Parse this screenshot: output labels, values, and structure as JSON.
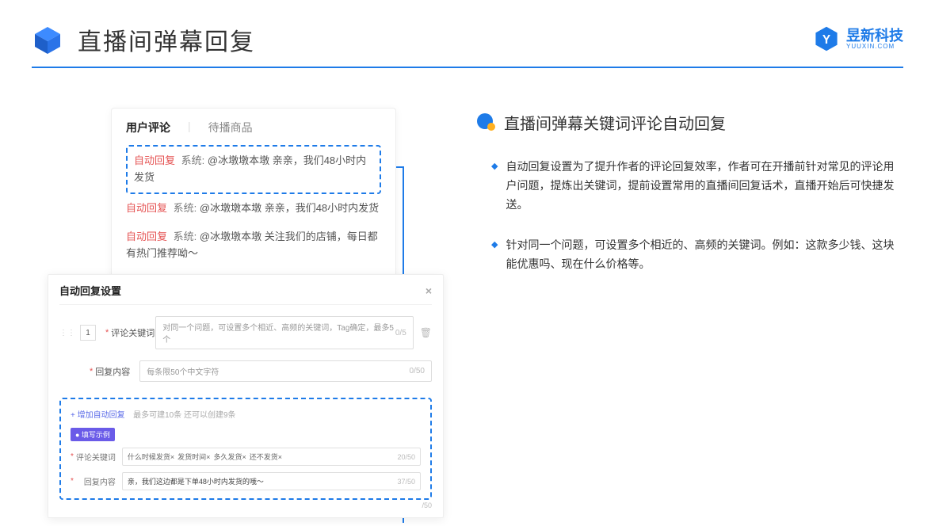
{
  "header": {
    "title": "直播间弹幕回复"
  },
  "brand": {
    "name": "昱新科技",
    "sub": "YUUXIN.COM"
  },
  "comments": {
    "tab1": "用户评论",
    "tab2": "待播商品",
    "r1_tag": "自动回复",
    "r1_sys": "系统:",
    "r1_text": "@冰墩墩本墩 亲亲，我们48小时内发货",
    "r2_tag": "自动回复",
    "r2_sys": "系统:",
    "r2_text": "@冰墩墩本墩 亲亲，我们48小时内发货",
    "r3_tag": "自动回复",
    "r3_sys": "系统:",
    "r3_text": "@冰墩墩本墩 关注我们的店铺，每日都有热门推荐呦～"
  },
  "settings": {
    "title": "自动回复设置",
    "num": "1",
    "label_keyword": "评论关键词",
    "placeholder_keyword": "对同一个问题，可设置多个相近、高频的关键词，Tag确定，最多5个",
    "count_kw": "0/5",
    "label_content": "回复内容",
    "placeholder_content": "每条限50个中文字符",
    "count_ct": "0/50",
    "add_link": "+ 增加自动回复",
    "add_hint": "最多可建10条 还可以创建9条",
    "badge": "● 填写示例",
    "ex_label_kw": "评论关键词",
    "chip1": "什么时候发货×",
    "chip2": "发货时间×",
    "chip3": "多久发货×",
    "chip4": "还不发货×",
    "ex_count_kw": "20/50",
    "ex_label_ct": "回复内容",
    "ex_content": "亲，我们这边都是下单48小时内发货的哦～",
    "ex_count_ct": "37/50",
    "outer_count": "/50"
  },
  "right": {
    "section_title": "直播间弹幕关键词评论自动回复",
    "p1": "自动回复设置为了提升作者的评论回复效率，作者可在开播前针对常见的评论用户问题，提炼出关键词，提前设置常用的直播间回复话术，直播开始后可快捷发送。",
    "p2": "针对同一个问题，可设置多个相近的、高频的关键词。例如：这款多少钱、这块能优惠吗、现在什么价格等。"
  }
}
